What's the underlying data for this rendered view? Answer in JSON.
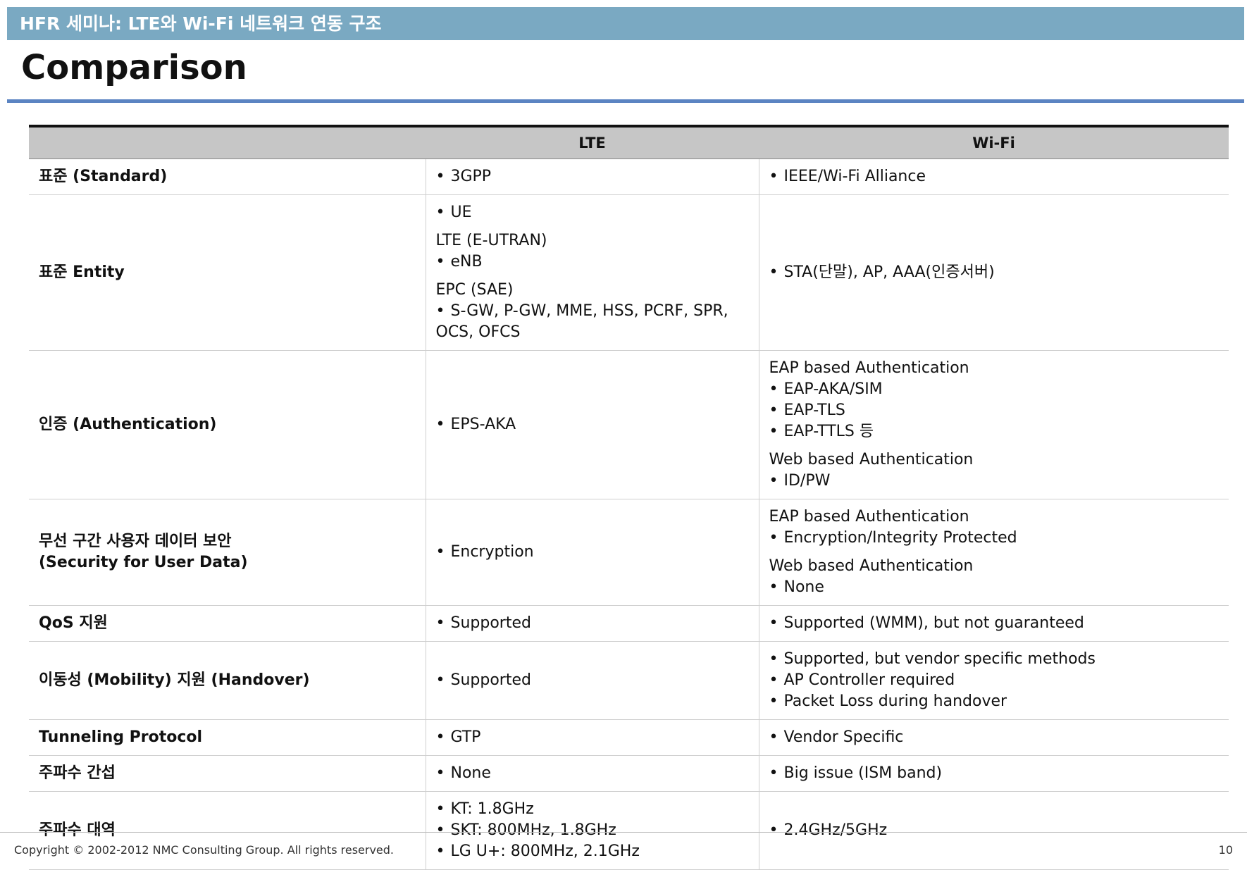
{
  "header": {
    "title": "HFR 세미나: LTE와 Wi-Fi 네트워크 연동 구조"
  },
  "page_title": "Comparison",
  "table": {
    "columns": [
      "",
      "LTE",
      "Wi-Fi"
    ],
    "rows": [
      {
        "feature": [
          "표준 (Standard)"
        ],
        "lte": [
          {
            "t": "b",
            "v": "3GPP"
          }
        ],
        "wifi": [
          {
            "t": "b",
            "v": "IEEE/Wi-Fi Alliance"
          }
        ]
      },
      {
        "feature": [
          "표준 Entity"
        ],
        "lte": [
          {
            "t": "b",
            "v": "UE"
          },
          {
            "t": "h",
            "v": "LTE (E-UTRAN)"
          },
          {
            "t": "b",
            "v": "eNB"
          },
          {
            "t": "h",
            "v": "EPC (SAE)"
          },
          {
            "t": "b",
            "v": "S-GW, P-GW, MME, HSS, PCRF, SPR, OCS, OFCS"
          }
        ],
        "wifi": [
          {
            "t": "b",
            "v": "STA(단말), AP, AAA(인증서버)"
          }
        ]
      },
      {
        "feature": [
          "인증 (Authentication)"
        ],
        "lte": [
          {
            "t": "b",
            "v": "EPS-AKA"
          }
        ],
        "wifi": [
          {
            "t": "h",
            "v": "EAP based Authentication"
          },
          {
            "t": "b",
            "v": "EAP-AKA/SIM"
          },
          {
            "t": "b",
            "v": "EAP-TLS"
          },
          {
            "t": "b",
            "v": "EAP-TTLS 등"
          },
          {
            "t": "h",
            "v": "Web based Authentication"
          },
          {
            "t": "b",
            "v": "ID/PW"
          }
        ]
      },
      {
        "feature": [
          "무선 구간 사용자 데이터 보안",
          "(Security for User Data)"
        ],
        "lte": [
          {
            "t": "b",
            "v": "Encryption"
          }
        ],
        "wifi": [
          {
            "t": "h",
            "v": "EAP based Authentication"
          },
          {
            "t": "b",
            "v": "Encryption/Integrity Protected"
          },
          {
            "t": "h",
            "v": "Web based Authentication"
          },
          {
            "t": "b",
            "v": "None"
          }
        ]
      },
      {
        "feature": [
          "QoS 지원"
        ],
        "lte": [
          {
            "t": "b",
            "v": "Supported"
          }
        ],
        "wifi": [
          {
            "t": "b",
            "v": "Supported (WMM), but not guaranteed"
          }
        ]
      },
      {
        "feature": [
          "이동성 (Mobility) 지원 (Handover)"
        ],
        "lte": [
          {
            "t": "b",
            "v": "Supported"
          }
        ],
        "wifi": [
          {
            "t": "b",
            "v": "Supported, but vendor specific methods"
          },
          {
            "t": "b",
            "v": "AP Controller required"
          },
          {
            "t": "b",
            "v": "Packet Loss during handover"
          }
        ]
      },
      {
        "feature": [
          "Tunneling Protocol"
        ],
        "lte": [
          {
            "t": "b",
            "v": "GTP"
          }
        ],
        "wifi": [
          {
            "t": "b",
            "v": "Vendor Specific"
          }
        ]
      },
      {
        "feature": [
          "주파수 간섭"
        ],
        "lte": [
          {
            "t": "b",
            "v": "None"
          }
        ],
        "wifi": [
          {
            "t": "b",
            "v": "Big issue (ISM band)"
          }
        ]
      },
      {
        "feature": [
          "주파수 대역"
        ],
        "lte": [
          {
            "t": "b",
            "v": "KT: 1.8GHz"
          },
          {
            "t": "b",
            "v": "SKT: 800MHz, 1.8GHz"
          },
          {
            "t": "b",
            "v": "LG U+: 800MHz, 2.1GHz"
          }
        ],
        "wifi": [
          {
            "t": "b",
            "v": "2.4GHz/5GHz"
          }
        ]
      }
    ]
  },
  "footer": {
    "copyright": "Copyright © 2002-2012 NMC Consulting Group. All rights reserved.",
    "page_number": "10"
  },
  "colors": {
    "header_bar": "#7aa9c2",
    "title_rule": "#5b84c2",
    "table_header": "#c6c6c6"
  }
}
